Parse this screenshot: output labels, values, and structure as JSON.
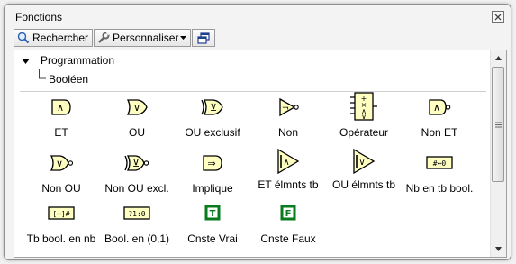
{
  "window": {
    "title": "Fonctions"
  },
  "toolbar": {
    "search_label": "Rechercher",
    "customize_label": "Personnaliser"
  },
  "tree": {
    "root": "Programmation",
    "child": "Booléen"
  },
  "items": [
    {
      "label": "ET",
      "icon": "and-icon"
    },
    {
      "label": "OU",
      "icon": "or-icon"
    },
    {
      "label": "OU exclusif",
      "icon": "xor-icon"
    },
    {
      "label": "Non",
      "icon": "not-icon"
    },
    {
      "label": "Opérateur",
      "icon": "compound-operator-icon"
    },
    {
      "label": "Non ET",
      "icon": "nand-icon"
    },
    {
      "label": "Non OU",
      "icon": "nor-icon"
    },
    {
      "label": "Non OU excl.",
      "icon": "xnor-icon"
    },
    {
      "label": "Implique",
      "icon": "implies-icon"
    },
    {
      "label": "ET élmnts tb",
      "icon": "and-array-elements-icon"
    },
    {
      "label": "OU élmnts tb",
      "icon": "or-array-elements-icon"
    },
    {
      "label": "Nb en tb bool.",
      "icon": "number-to-boolean-array-icon"
    },
    {
      "label": "Tb bool. en nb",
      "icon": "boolean-array-to-number-icon"
    },
    {
      "label": "Bool. en (0,1)",
      "icon": "boolean-to-0-1-icon"
    },
    {
      "label": "Cnste Vrai",
      "icon": "true-constant-icon"
    },
    {
      "label": "Cnste Faux",
      "icon": "false-constant-icon"
    }
  ],
  "icon_text": {
    "and": "∧",
    "or": "∨",
    "xor": "⊻",
    "not": "¬",
    "nand": "∧",
    "nor": "∨",
    "xnor": "⊻",
    "implies": "⇒",
    "and_arr": "∧",
    "or_arr": "∨",
    "num_to_bool": "#⋯0",
    "bool_to_num": "[⋯]#",
    "bool_01": "?1:0",
    "true": "T",
    "false": "F"
  },
  "colors": {
    "gate_fill": "#ffffc2",
    "constant_green": "#0a7a1e"
  }
}
